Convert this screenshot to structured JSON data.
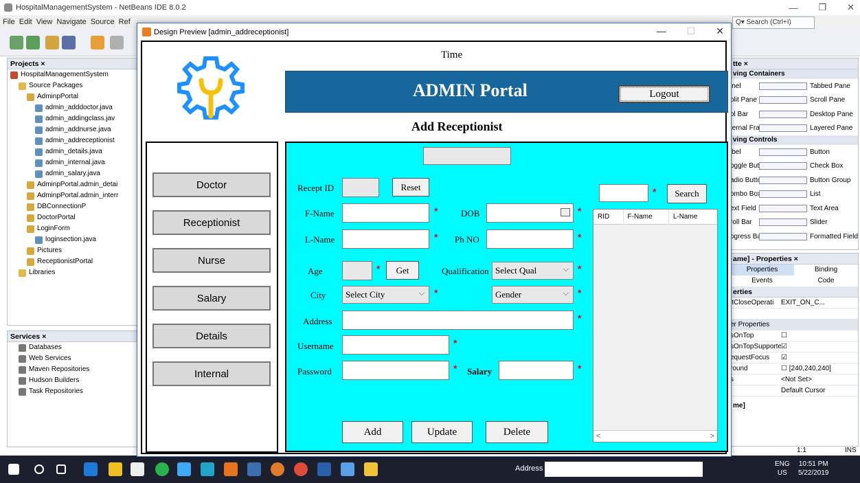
{
  "ide": {
    "title": "HospitalManagementSystem - NetBeans IDE 8.0.2",
    "menu": [
      "File",
      "Edit",
      "View",
      "Navigate",
      "Source",
      "Ref"
    ],
    "search_placeholder": "Search (Ctrl+I)",
    "projects_tab": "Projects ×",
    "project_tree": [
      {
        "label": "HospitalManagementSystem",
        "indent": 0,
        "icon": "proj"
      },
      {
        "label": "Source Packages",
        "indent": 1,
        "icon": "folder"
      },
      {
        "label": "AdminpPortal",
        "indent": 2,
        "icon": "pkg"
      },
      {
        "label": "admin_adddoctor.java",
        "indent": 3,
        "icon": "java"
      },
      {
        "label": "admin_addingclass.jav",
        "indent": 3,
        "icon": "java"
      },
      {
        "label": "admin_addnurse.java",
        "indent": 3,
        "icon": "java"
      },
      {
        "label": "admin_addreceptionist",
        "indent": 3,
        "icon": "java"
      },
      {
        "label": "admin_details.java",
        "indent": 3,
        "icon": "java"
      },
      {
        "label": "admin_internal.java",
        "indent": 3,
        "icon": "java"
      },
      {
        "label": "admin_salary.java",
        "indent": 3,
        "icon": "java"
      },
      {
        "label": "AdminpPortal.admin_detai",
        "indent": 2,
        "icon": "pkg"
      },
      {
        "label": "AdminpPortal.admin_interr",
        "indent": 2,
        "icon": "pkg"
      },
      {
        "label": "DBConnectionP",
        "indent": 2,
        "icon": "pkg"
      },
      {
        "label": "DoctorPortal",
        "indent": 2,
        "icon": "pkg"
      },
      {
        "label": "LoginForm",
        "indent": 2,
        "icon": "pkg"
      },
      {
        "label": "loginsection.java",
        "indent": 3,
        "icon": "java"
      },
      {
        "label": "Pictures",
        "indent": 2,
        "icon": "pkg"
      },
      {
        "label": "ReceptionistPortal",
        "indent": 2,
        "icon": "pkg"
      },
      {
        "label": "Libraries",
        "indent": 1,
        "icon": "folder"
      }
    ],
    "services_tab": "Services ×",
    "services": [
      "Databases",
      "Web Services",
      "Maven Repositories",
      "Hudson Builders",
      "Task Repositories"
    ],
    "palette_tab": "tte ×",
    "palette": [
      {
        "section": "ving Containers"
      },
      {
        "left": "inel",
        "right": "Tabbed Pane"
      },
      {
        "left": "olit Pane",
        "right": "Scroll Pane"
      },
      {
        "left": "ol Bar",
        "right": "Desktop Pane"
      },
      {
        "left": "ternal Frame",
        "right": "Layered Pane"
      },
      {
        "section": "ving Controls"
      },
      {
        "left": "ibel",
        "right": "Button"
      },
      {
        "left": "oggle Button",
        "right": "Check Box"
      },
      {
        "left": "adio Button",
        "right": "Button Group"
      },
      {
        "left": "ombo Box",
        "right": "List"
      },
      {
        "left": "ext Field",
        "right": "Text Area"
      },
      {
        "left": "roll Bar",
        "right": "Slider"
      },
      {
        "left": "ogress Bar",
        "right": "Formatted Field"
      }
    ],
    "props_tab": "ame] - Properties ×",
    "props_tabs": [
      "Properties",
      "Binding",
      "Events",
      "Code"
    ],
    "props_section1": "erties",
    "props_rows": [
      {
        "k": "ltCloseOperati",
        "v": "EXIT_ON_C..."
      },
      {
        "k": "",
        "v": ""
      },
      {
        "section": "er Properties"
      },
      {
        "k": "sOnTop",
        "v": "☐"
      },
      {
        "k": "sOnTopSupporte",
        "v": "☑"
      },
      {
        "k": "equestFocus",
        "v": "☑"
      },
      {
        "k": "round",
        "v": "☐ [240,240,240]"
      },
      {
        "k": "s",
        "v": "<Not Set>"
      },
      {
        "k": "",
        "v": "Default Cursor"
      }
    ],
    "props_footer": "me]",
    "status_zoom": "1:1",
    "status_ins": "INS"
  },
  "taskbar": {
    "address_label": "Address",
    "lang": "ENG",
    "region": "US",
    "time": "10:51 PM",
    "date": "5/22/2019"
  },
  "dialog": {
    "title": "Design Preview [admin_addreceptionist]"
  },
  "form": {
    "time_label": "Time",
    "header_title": "ADMIN Portal",
    "logout": "Logout",
    "subtitle": "Add Receptionist",
    "nav": [
      "Doctor",
      "Receptionist",
      "Nurse",
      "Salary",
      "Details",
      "Internal"
    ],
    "labels": {
      "recept_id": "Recept ID",
      "fname": "F-Name",
      "lname": "L-Name",
      "age": "Age",
      "city": "City",
      "address": "Address",
      "username": "Username",
      "password": "Password",
      "dob": "DOB",
      "phno": "Ph NO",
      "qualification": "Qualification",
      "salary": "Salary"
    },
    "buttons": {
      "reset": "Reset",
      "get": "Get",
      "search": "Search",
      "add": "Add",
      "update": "Update",
      "delete": "Delete"
    },
    "selects": {
      "qualification": "Select Qual",
      "city": "Select City",
      "gender": "Gender"
    },
    "table_headers": [
      "RID",
      "F-Name",
      "L-Name"
    ],
    "required_mark": "*",
    "colors": {
      "banner": "#17679c",
      "panel": "#00fbff",
      "required": "#d4122f",
      "logo": "#1e90ff",
      "logo_wrench": "#f4c20d"
    }
  }
}
